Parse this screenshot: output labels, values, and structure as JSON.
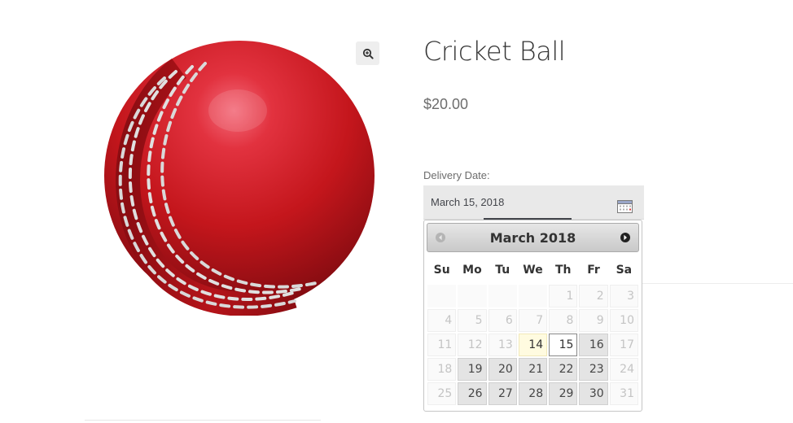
{
  "product": {
    "title": "Cricket Ball",
    "price": "$20.00",
    "image_icon": "cricket-ball-image",
    "zoom_icon": "zoom-in-icon"
  },
  "delivery": {
    "label": "Delivery Date:",
    "value": "March 15, 2018",
    "calendar_icon": "calendar-icon"
  },
  "datepicker": {
    "month_title": "March 2018",
    "prev_icon": "prev-arrow-icon",
    "next_icon": "next-arrow-icon",
    "weekdays": [
      "Su",
      "Mo",
      "Tu",
      "We",
      "Th",
      "Fr",
      "Sa"
    ],
    "weeks": [
      [
        {
          "d": ""
        },
        {
          "d": ""
        },
        {
          "d": ""
        },
        {
          "d": ""
        },
        {
          "d": "1",
          "s": "disabled"
        },
        {
          "d": "2",
          "s": "disabled"
        },
        {
          "d": "3",
          "s": "disabled"
        }
      ],
      [
        {
          "d": "4",
          "s": "disabled"
        },
        {
          "d": "5",
          "s": "disabled"
        },
        {
          "d": "6",
          "s": "disabled"
        },
        {
          "d": "7",
          "s": "disabled"
        },
        {
          "d": "8",
          "s": "disabled"
        },
        {
          "d": "9",
          "s": "disabled"
        },
        {
          "d": "10",
          "s": "disabled"
        }
      ],
      [
        {
          "d": "11",
          "s": "disabled"
        },
        {
          "d": "12",
          "s": "disabled"
        },
        {
          "d": "13",
          "s": "disabled"
        },
        {
          "d": "14",
          "s": "today"
        },
        {
          "d": "15",
          "s": "selected"
        },
        {
          "d": "16",
          "s": "enabled"
        },
        {
          "d": "17",
          "s": "disabled"
        }
      ],
      [
        {
          "d": "18",
          "s": "disabled"
        },
        {
          "d": "19",
          "s": "enabled"
        },
        {
          "d": "20",
          "s": "enabled"
        },
        {
          "d": "21",
          "s": "enabled"
        },
        {
          "d": "22",
          "s": "enabled"
        },
        {
          "d": "23",
          "s": "enabled"
        },
        {
          "d": "24",
          "s": "disabled"
        }
      ],
      [
        {
          "d": "25",
          "s": "disabled"
        },
        {
          "d": "26",
          "s": "enabled"
        },
        {
          "d": "27",
          "s": "enabled"
        },
        {
          "d": "28",
          "s": "enabled"
        },
        {
          "d": "29",
          "s": "enabled"
        },
        {
          "d": "30",
          "s": "enabled"
        },
        {
          "d": "31",
          "s": "disabled"
        }
      ]
    ]
  },
  "colors": {
    "ball_red": "#c4161c",
    "seam": "#d9d9d9",
    "header_gradient_top": "#e6e6e6",
    "header_gradient_bottom": "#c9c9c9"
  }
}
